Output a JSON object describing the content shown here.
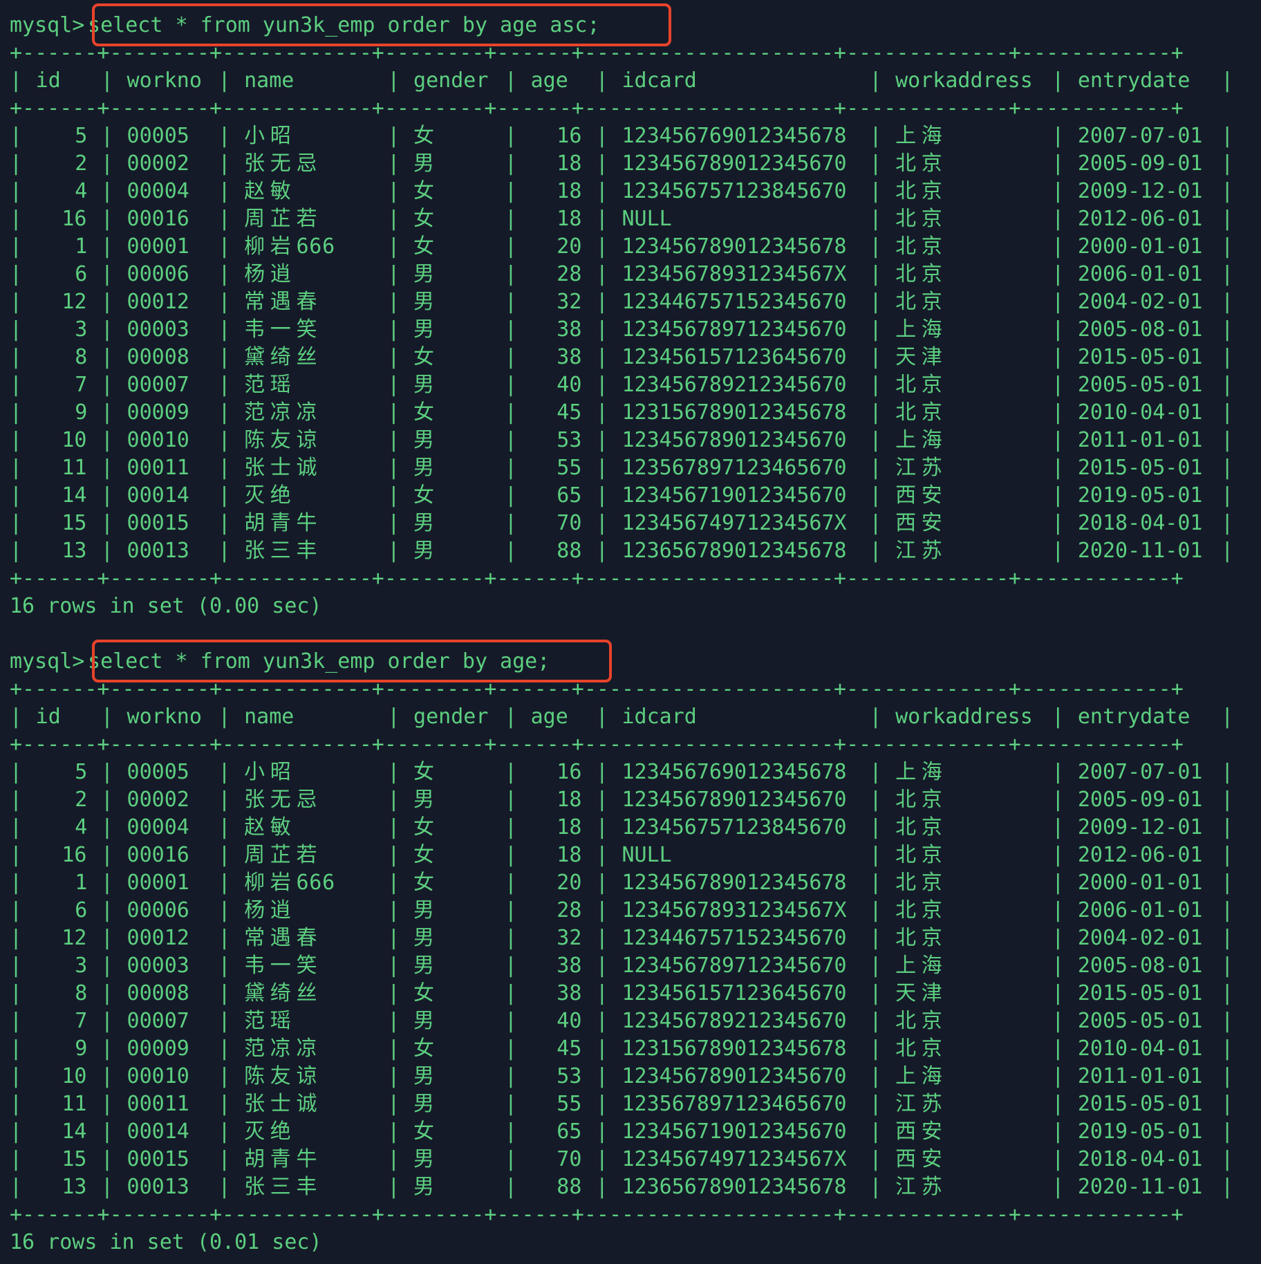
{
  "terminal": {
    "prompt": "mysql>",
    "colors": {
      "background": "#151a29",
      "text": "#5ccf7f",
      "highlight_box": "#e8432a"
    }
  },
  "columns": [
    "id",
    "workno",
    "name",
    "gender",
    "age",
    "idcard",
    "workaddress",
    "entrydate"
  ],
  "rows": [
    [
      "5",
      "00005",
      "小昭",
      "女",
      "16",
      "123456769012345678",
      "上海",
      "2007-07-01"
    ],
    [
      "2",
      "00002",
      "张无忌",
      "男",
      "18",
      "123456789012345670",
      "北京",
      "2005-09-01"
    ],
    [
      "4",
      "00004",
      "赵敏",
      "女",
      "18",
      "123456757123845670",
      "北京",
      "2009-12-01"
    ],
    [
      "16",
      "00016",
      "周芷若",
      "女",
      "18",
      "NULL",
      "北京",
      "2012-06-01"
    ],
    [
      "1",
      "00001",
      "柳岩666",
      "女",
      "20",
      "123456789012345678",
      "北京",
      "2000-01-01"
    ],
    [
      "6",
      "00006",
      "杨逍",
      "男",
      "28",
      "12345678931234567X",
      "北京",
      "2006-01-01"
    ],
    [
      "12",
      "00012",
      "常遇春",
      "男",
      "32",
      "123446757152345670",
      "北京",
      "2004-02-01"
    ],
    [
      "3",
      "00003",
      "韦一笑",
      "男",
      "38",
      "123456789712345670",
      "上海",
      "2005-08-01"
    ],
    [
      "8",
      "00008",
      "黛绮丝",
      "女",
      "38",
      "123456157123645670",
      "天津",
      "2015-05-01"
    ],
    [
      "7",
      "00007",
      "范瑶",
      "男",
      "40",
      "123456789212345670",
      "北京",
      "2005-05-01"
    ],
    [
      "9",
      "00009",
      "范凉凉",
      "女",
      "45",
      "123156789012345678",
      "北京",
      "2010-04-01"
    ],
    [
      "10",
      "00010",
      "陈友谅",
      "男",
      "53",
      "123456789012345670",
      "上海",
      "2011-01-01"
    ],
    [
      "11",
      "00011",
      "张士诚",
      "男",
      "55",
      "123567897123465670",
      "江苏",
      "2015-05-01"
    ],
    [
      "14",
      "00014",
      "灭绝",
      "女",
      "65",
      "123456719012345670",
      "西安",
      "2019-05-01"
    ],
    [
      "15",
      "00015",
      "胡青牛",
      "男",
      "70",
      "12345674971234567X",
      "西安",
      "2018-04-01"
    ],
    [
      "13",
      "00013",
      "张三丰",
      "男",
      "88",
      "123656789012345678",
      "江苏",
      "2020-11-01"
    ]
  ],
  "queries": [
    {
      "sql": "select * from yun3k_emp order by age asc;",
      "result_summary": "16 rows in set (0.00 sec)"
    },
    {
      "sql": "select * from yun3k_emp order by age;",
      "result_summary": "16 rows in set (0.01 sec)"
    }
  ]
}
